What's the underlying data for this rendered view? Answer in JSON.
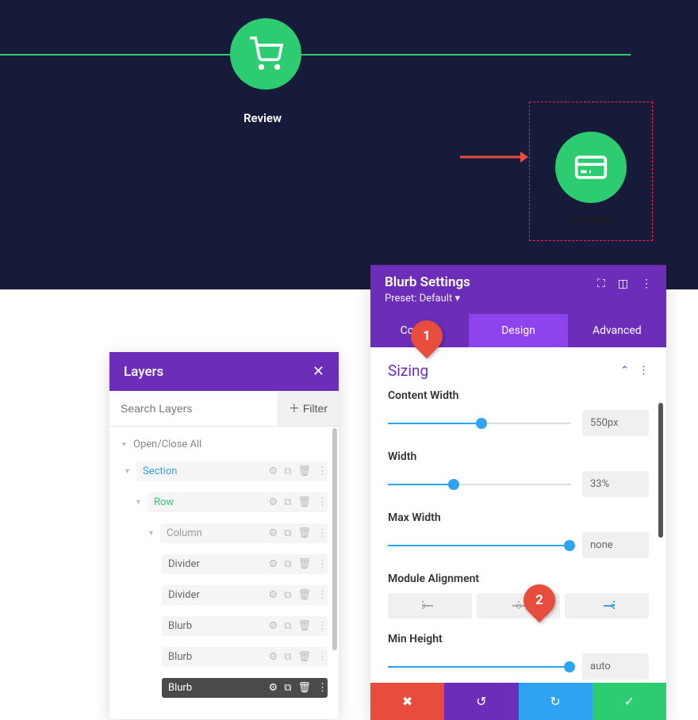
{
  "progress": {
    "review_label": "Review",
    "checkout_label": "Checkout"
  },
  "layers": {
    "title": "Layers",
    "search_placeholder": "Search Layers",
    "filter_label": "Filter",
    "open_close": "Open/Close All",
    "items": [
      {
        "label": "Section"
      },
      {
        "label": "Row"
      },
      {
        "label": "Column"
      },
      {
        "label": "Divider"
      },
      {
        "label": "Divider"
      },
      {
        "label": "Blurb"
      },
      {
        "label": "Blurb"
      },
      {
        "label": "Blurb"
      }
    ]
  },
  "settings": {
    "title": "Blurb Settings",
    "preset": "Preset: Default",
    "tabs": {
      "content": "Content",
      "design": "Design",
      "advanced": "Advanced"
    },
    "section_title": "Sizing",
    "controls": {
      "content_width": {
        "label": "Content Width",
        "value": "550px"
      },
      "width": {
        "label": "Width",
        "value": "33%"
      },
      "max_width": {
        "label": "Max Width",
        "value": "none"
      },
      "module_alignment": {
        "label": "Module Alignment"
      },
      "min_height": {
        "label": "Min Height",
        "value": "auto"
      }
    }
  },
  "callouts": {
    "c1": "1",
    "c2": "2"
  }
}
